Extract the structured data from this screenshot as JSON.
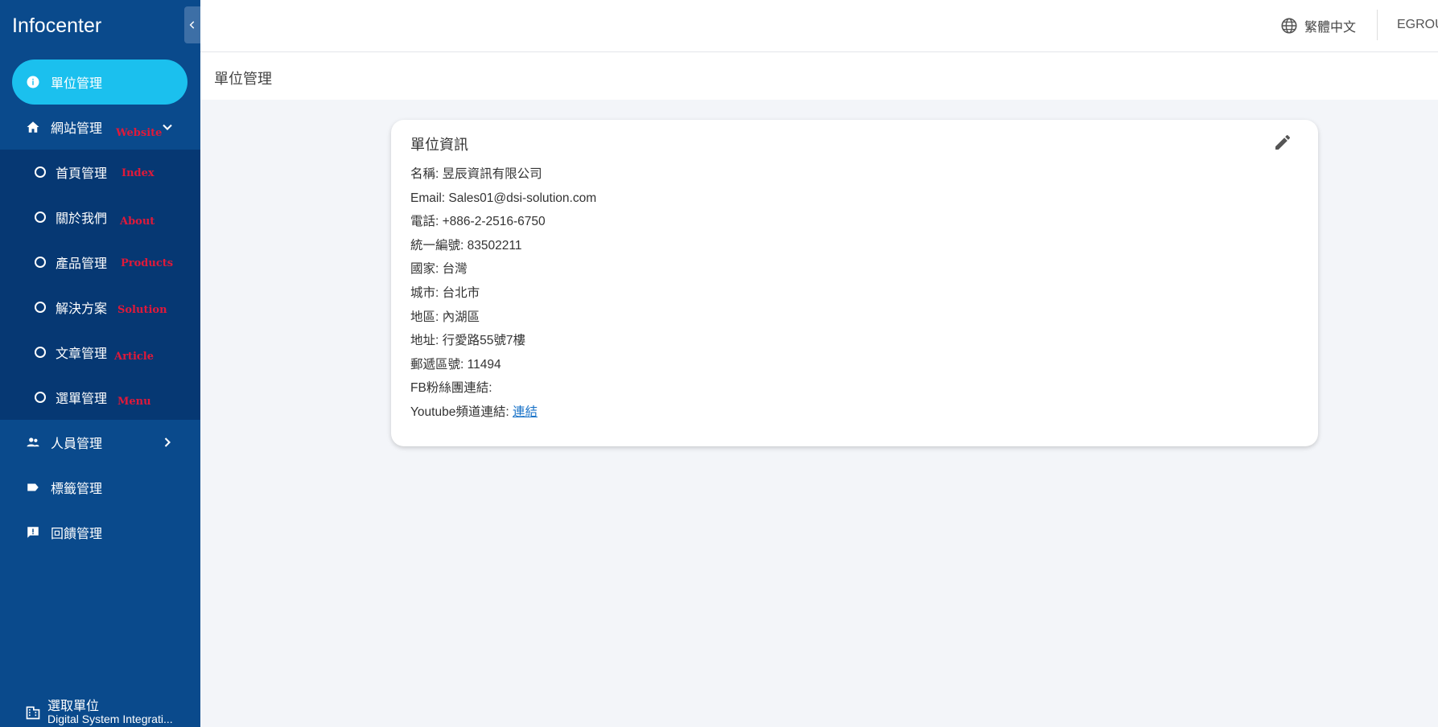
{
  "app": {
    "title": "Infocenter"
  },
  "sidebar": {
    "items": [
      {
        "label": "單位管理",
        "icon": "info-icon",
        "active": true
      },
      {
        "label": "網站管理",
        "icon": "home-icon",
        "annotation": "Website",
        "expanded": true
      },
      {
        "label": "人員管理",
        "icon": "people-icon"
      },
      {
        "label": "標籤管理",
        "icon": "label-icon"
      },
      {
        "label": "回饋管理",
        "icon": "feedback-icon"
      }
    ],
    "submenu": [
      {
        "label": "首頁管理",
        "annotation": "Index"
      },
      {
        "label": "關於我們",
        "annotation": "About"
      },
      {
        "label": "產品管理",
        "annotation": "Products"
      },
      {
        "label": "解決方案",
        "annotation": "Solution"
      },
      {
        "label": "文章管理",
        "annotation": "Article"
      },
      {
        "label": "選單管理",
        "annotation": "Menu"
      }
    ],
    "select_unit": {
      "label": "選取單位",
      "value": "Digital System Integrati..."
    }
  },
  "header": {
    "language": "繁體中文",
    "user": "EGROU"
  },
  "breadcrumb": "單位管理",
  "card": {
    "title": "單位資訊",
    "rows": [
      {
        "label": "名稱:",
        "value": "昱辰資訊有限公司"
      },
      {
        "label": "Email:",
        "value": "Sales01@dsi-solution.com"
      },
      {
        "label": "電話:",
        "value": "+886-2-2516-6750"
      },
      {
        "label": "統一編號:",
        "value": "83502211"
      },
      {
        "label": "國家:",
        "value": "台灣"
      },
      {
        "label": "城市:",
        "value": "台北市"
      },
      {
        "label": "地區:",
        "value": "內湖區"
      },
      {
        "label": "地址:",
        "value": "行愛路55號7樓"
      },
      {
        "label": "郵遞區號:",
        "value": "11494"
      },
      {
        "label": "FB粉絲團連結:",
        "value": ""
      },
      {
        "label": "Youtube頻道連結:",
        "value": "",
        "link": "連結"
      }
    ]
  },
  "colors": {
    "sidebar_bg": "#0a4a8c",
    "submenu_bg": "#063873",
    "active_bg": "#1bc0ee",
    "annotation": "#e0193a",
    "link": "#1a73c8"
  }
}
